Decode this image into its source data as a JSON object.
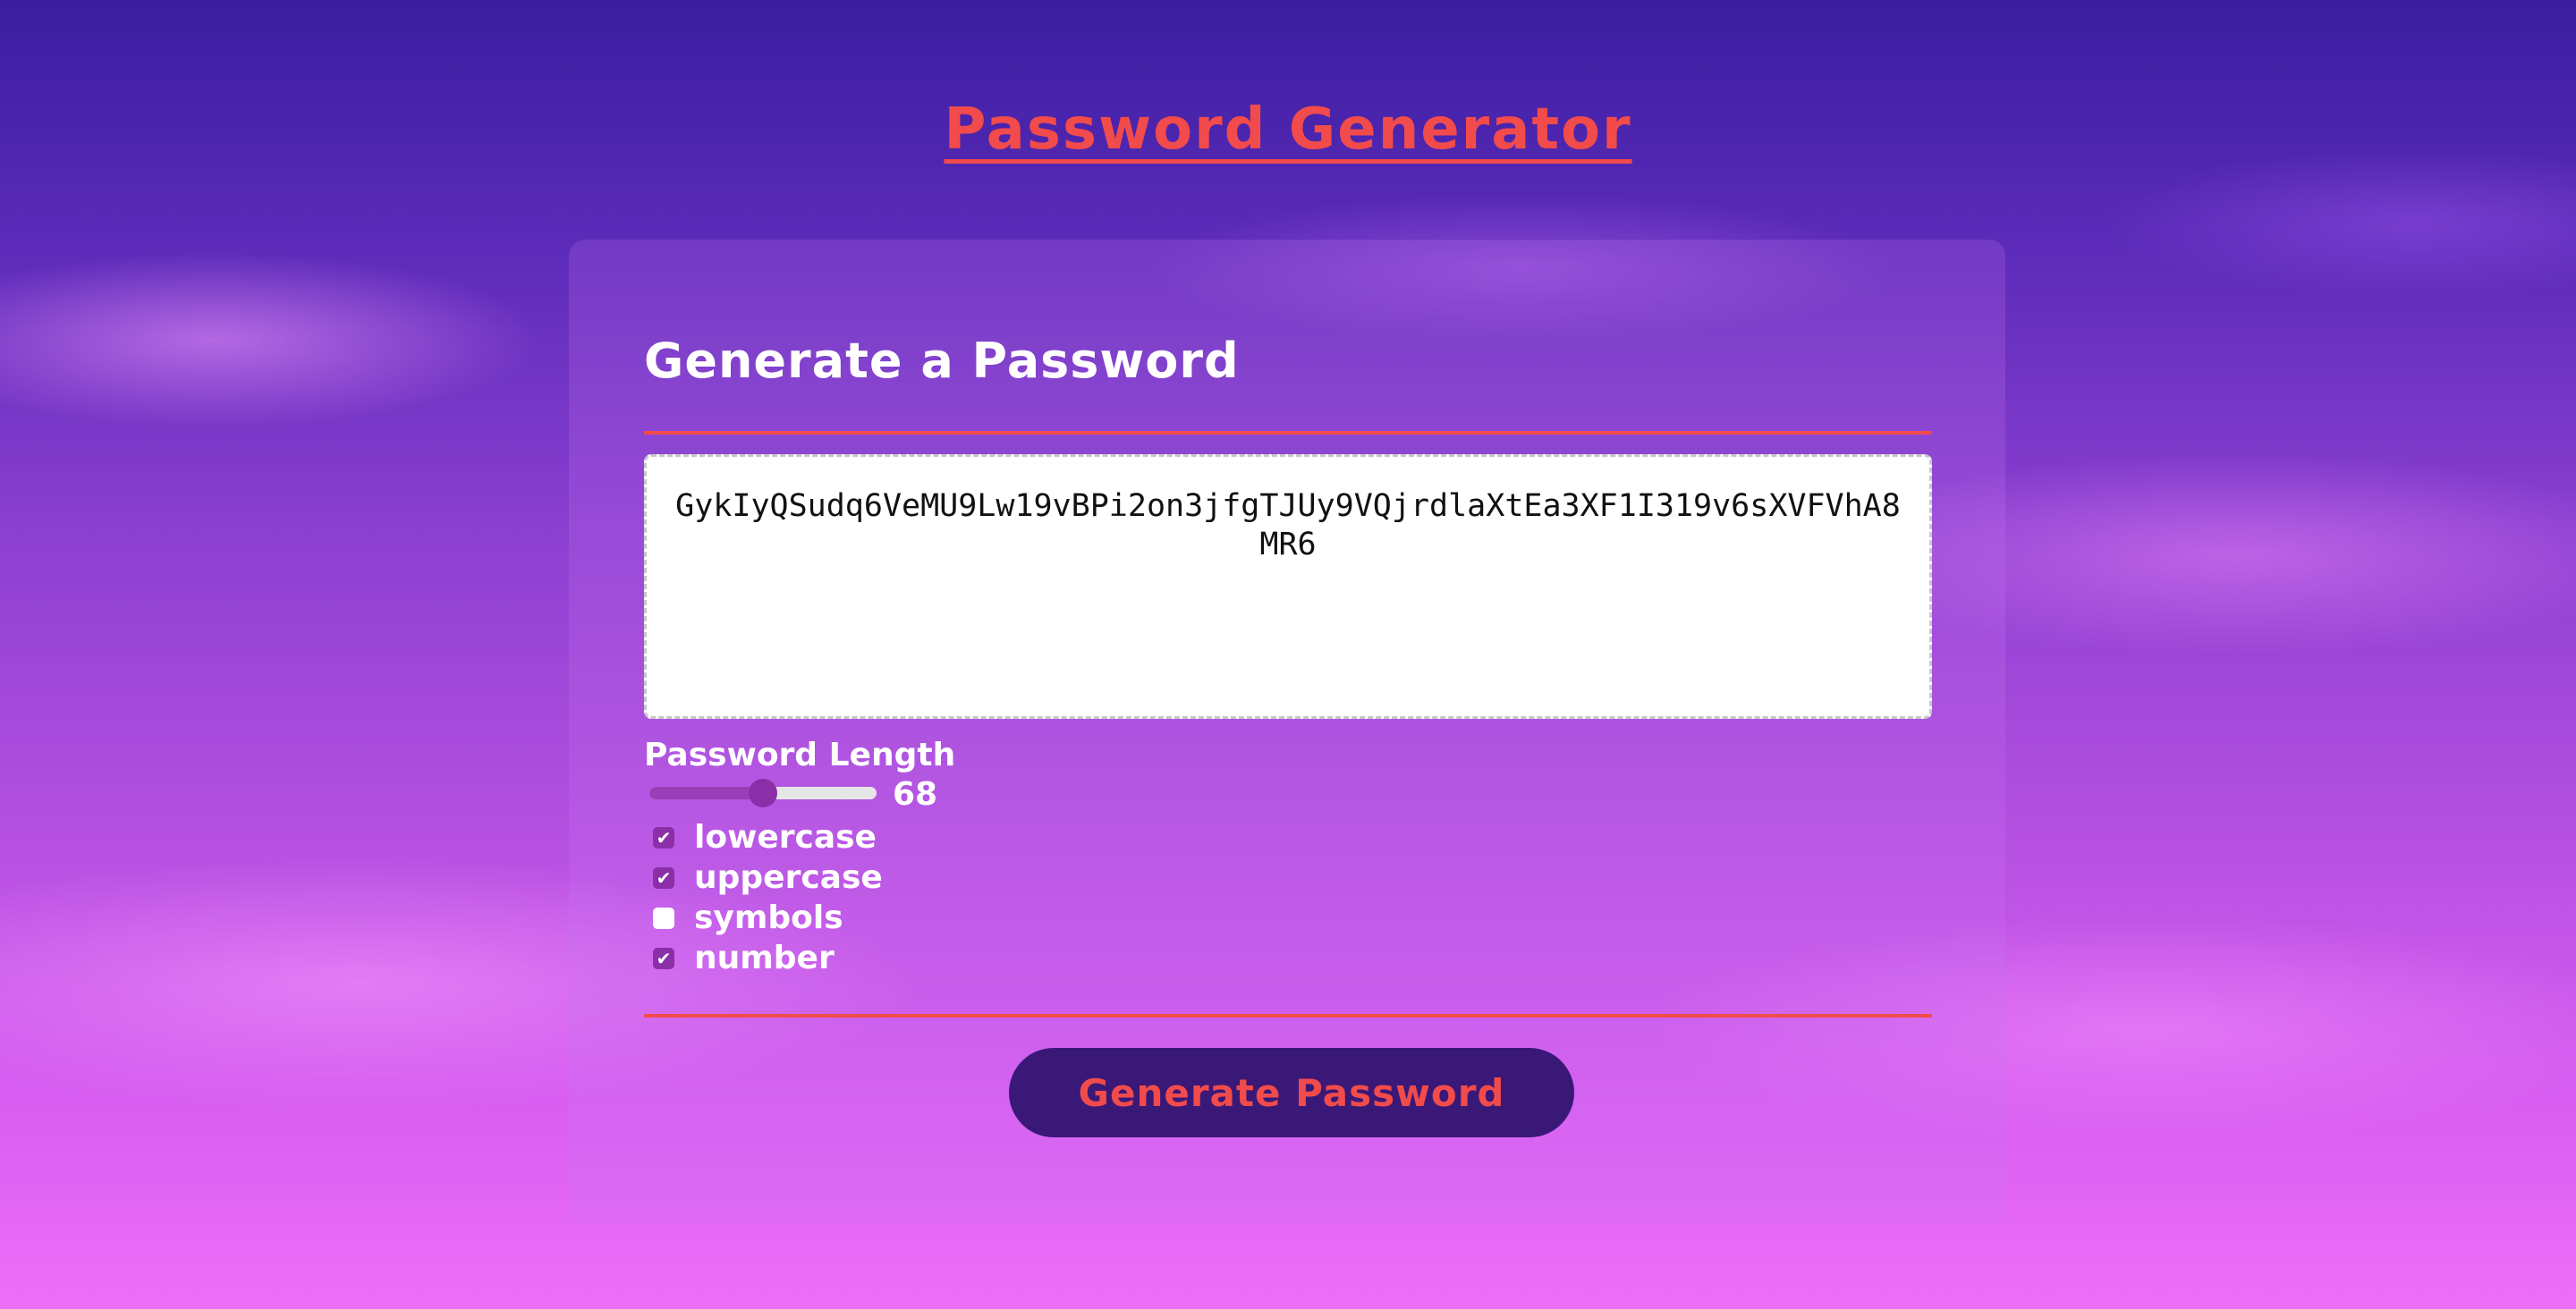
{
  "colors": {
    "accent": "#f24b4b",
    "button_bg": "#3a1878",
    "checkbox_on": "#8a2fa8"
  },
  "header": {
    "title": "Password Generator"
  },
  "card": {
    "title": "Generate a Password",
    "password": "GykIyQSudq6VeMU9Lw19vBPi2on3jfgTJUy9VQjrdlaXtEa3XF1I319v6sXVFVhA8MR6",
    "length_label": "Password Length",
    "length_value": "68",
    "length_fraction": 0.5,
    "options": [
      {
        "label": "lowercase",
        "checked": true
      },
      {
        "label": "uppercase",
        "checked": true
      },
      {
        "label": "symbols",
        "checked": false
      },
      {
        "label": "number",
        "checked": true
      }
    ],
    "button_label": "Generate Password"
  }
}
